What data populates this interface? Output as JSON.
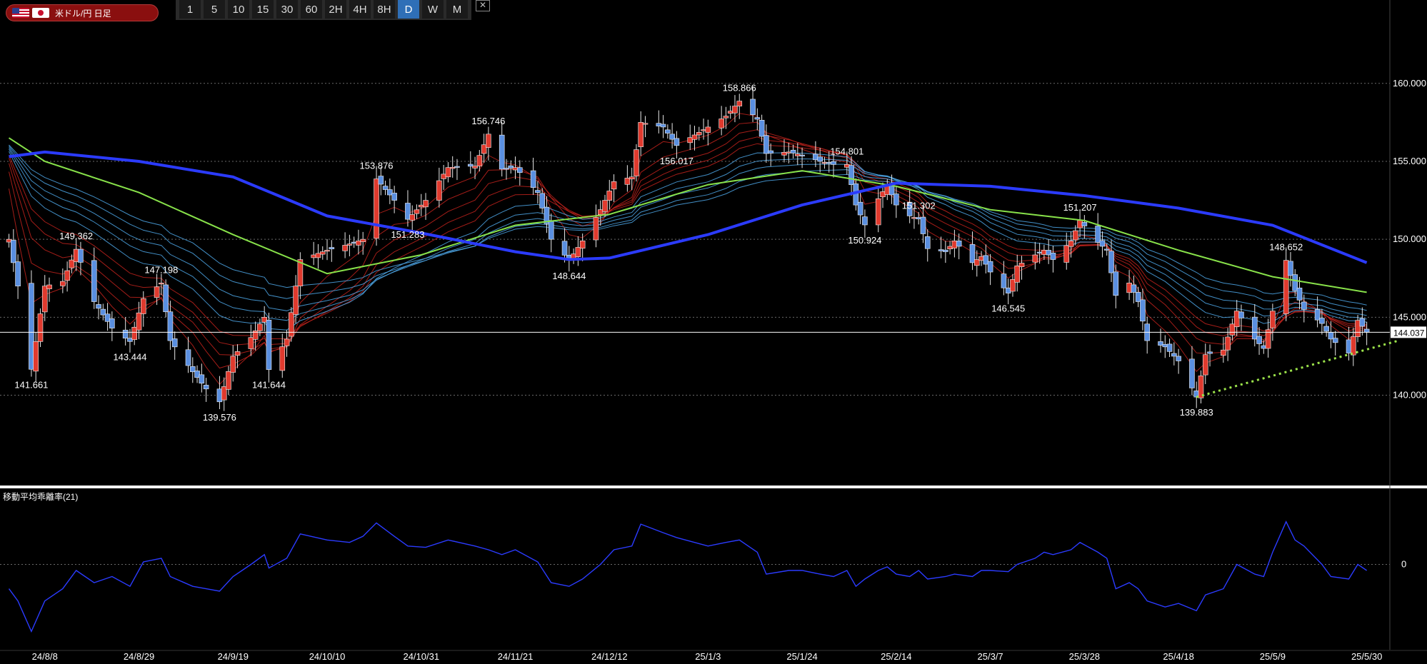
{
  "symbol": {
    "label": "米ドル/円 日足",
    "flags": [
      "us-flag-icon",
      "jp-flag-icon"
    ]
  },
  "timeframes": [
    "1",
    "5",
    "10",
    "15",
    "30",
    "60",
    "2H",
    "4H",
    "8H",
    "D",
    "W",
    "M"
  ],
  "active_timeframe": "D",
  "colors": {
    "background": "#000000",
    "bull": "#e03a2e",
    "bear": "#5a8fe0",
    "ma_long": "#2b3bff",
    "ma_mid": "#88e24a",
    "ribbon_red": "#c1221c",
    "ribbon_blue": "#4ea7e8",
    "deviation": "#2b3bff",
    "trendline": "#9be34a"
  },
  "chart_data": {
    "type": "candlestick",
    "price_axis": {
      "range": [
        134.3,
        162.6
      ],
      "ticks": [
        140.0,
        145.0,
        150.0,
        155.0,
        160.0
      ],
      "tick_labels": [
        "140.000",
        "145.000",
        "150.000",
        "155.000",
        "160.000"
      ]
    },
    "current_price": {
      "value": 144.037,
      "label": "144.037"
    },
    "x_axis_labels": [
      "24/8/8",
      "24/8/29",
      "24/9/19",
      "24/10/10",
      "24/10/31",
      "24/11/21",
      "24/12/12",
      "25/1/3",
      "25/1/24",
      "25/2/14",
      "25/3/7",
      "25/3/28",
      "25/4/18",
      "25/5/9",
      "25/5/30"
    ],
    "annotations": [
      {
        "label": "141.661",
        "value": 141.661,
        "date": "24/8/5",
        "pos": "below"
      },
      {
        "label": "149.362",
        "value": 149.362,
        "date": "24/8/15",
        "pos": "above"
      },
      {
        "label": "143.444",
        "value": 143.444,
        "date": "24/8/27",
        "pos": "below"
      },
      {
        "label": "147.198",
        "value": 147.198,
        "date": "24/9/3",
        "pos": "above"
      },
      {
        "label": "139.576",
        "value": 139.576,
        "date": "24/9/16",
        "pos": "below"
      },
      {
        "label": "141.644",
        "value": 141.644,
        "date": "24/9/27",
        "pos": "below"
      },
      {
        "label": "153.876",
        "value": 153.876,
        "date": "24/10/21",
        "pos": "above"
      },
      {
        "label": "151.283",
        "value": 151.283,
        "date": "24/10/28",
        "pos": "below"
      },
      {
        "label": "156.746",
        "value": 156.746,
        "date": "24/11/15",
        "pos": "above"
      },
      {
        "label": "148.644",
        "value": 148.644,
        "date": "24/12/3",
        "pos": "below"
      },
      {
        "label": "156.017",
        "value": 156.017,
        "date": "24/12/27",
        "pos": "below"
      },
      {
        "label": "158.866",
        "value": 158.866,
        "date": "25/1/10",
        "pos": "above"
      },
      {
        "label": "154.801",
        "value": 154.801,
        "date": "25/2/3",
        "pos": "above"
      },
      {
        "label": "150.924",
        "value": 150.924,
        "date": "25/2/7",
        "pos": "below"
      },
      {
        "label": "151.302",
        "value": 151.302,
        "date": "25/2/19",
        "pos": "above"
      },
      {
        "label": "146.545",
        "value": 146.545,
        "date": "25/3/11",
        "pos": "below"
      },
      {
        "label": "151.207",
        "value": 151.207,
        "date": "25/3/27",
        "pos": "above"
      },
      {
        "label": "139.883",
        "value": 139.883,
        "date": "25/4/22",
        "pos": "below"
      },
      {
        "label": "148.652",
        "value": 148.652,
        "date": "25/5/12",
        "pos": "above"
      }
    ],
    "price_path": [
      [
        "24/7/31",
        150.0
      ],
      [
        "24/8/2",
        147.0
      ],
      [
        "24/8/5",
        141.661
      ],
      [
        "24/8/8",
        147.0
      ],
      [
        "24/8/12",
        147.3
      ],
      [
        "24/8/15",
        149.362
      ],
      [
        "24/8/19",
        146.0
      ],
      [
        "24/8/23",
        144.3
      ],
      [
        "24/8/27",
        143.444
      ],
      [
        "24/8/30",
        146.2
      ],
      [
        "24/9/3",
        147.198
      ],
      [
        "24/9/5",
        143.5
      ],
      [
        "24/9/10",
        141.5
      ],
      [
        "24/9/13",
        140.4
      ],
      [
        "24/9/16",
        139.576
      ],
      [
        "24/9/19",
        142.5
      ],
      [
        "24/9/23",
        143.7
      ],
      [
        "24/9/26",
        145.0
      ],
      [
        "24/9/27",
        141.644
      ],
      [
        "24/10/1",
        143.6
      ],
      [
        "24/10/4",
        148.7
      ],
      [
        "24/10/10",
        149.3
      ],
      [
        "24/10/15",
        149.7
      ],
      [
        "24/10/18",
        150.0
      ],
      [
        "24/10/21",
        153.876
      ],
      [
        "24/10/25",
        152.5
      ],
      [
        "24/10/28",
        151.283
      ],
      [
        "24/11/1",
        152.5
      ],
      [
        "24/11/6",
        154.6
      ],
      [
        "24/11/12",
        154.7
      ],
      [
        "24/11/15",
        156.746
      ],
      [
        "24/11/18",
        154.5
      ],
      [
        "24/11/21",
        154.6
      ],
      [
        "24/11/26",
        153.0
      ],
      [
        "24/11/29",
        150.0
      ],
      [
        "24/12/3",
        148.644
      ],
      [
        "24/12/6",
        149.9
      ],
      [
        "24/12/10",
        151.9
      ],
      [
        "24/12/13",
        153.7
      ],
      [
        "24/12/17",
        154.0
      ],
      [
        "24/12/19",
        157.5
      ],
      [
        "24/12/24",
        157.2
      ],
      [
        "24/12/27",
        156.017
      ],
      [
        "25/1/3",
        157.2
      ],
      [
        "25/1/7",
        157.9
      ],
      [
        "25/1/10",
        158.866
      ],
      [
        "25/1/14",
        157.7
      ],
      [
        "25/1/16",
        155.5
      ],
      [
        "25/1/21",
        155.6
      ],
      [
        "25/1/24",
        155.4
      ],
      [
        "25/1/28",
        155.0
      ],
      [
        "25/1/31",
        154.8
      ],
      [
        "25/2/3",
        154.801
      ],
      [
        "25/2/5",
        152.2
      ],
      [
        "25/2/7",
        150.924
      ],
      [
        "25/2/10",
        152.6
      ],
      [
        "25/2/12",
        153.5
      ],
      [
        "25/2/14",
        152.2
      ],
      [
        "25/2/17",
        151.5
      ],
      [
        "25/2/19",
        151.302
      ],
      [
        "25/2/21",
        149.4
      ],
      [
        "25/2/25",
        149.2
      ],
      [
        "25/2/27",
        149.9
      ],
      [
        "25/3/3",
        148.5
      ],
      [
        "25/3/5",
        148.9
      ],
      [
        "25/3/7",
        147.9
      ],
      [
        "25/3/11",
        146.545
      ],
      [
        "25/3/13",
        148.3
      ],
      [
        "25/3/17",
        149.0
      ],
      [
        "25/3/19",
        149.3
      ],
      [
        "25/3/21",
        148.7
      ],
      [
        "25/3/25",
        149.9
      ],
      [
        "25/3/27",
        151.207
      ],
      [
        "25/3/31",
        149.8
      ],
      [
        "25/4/2",
        149.3
      ],
      [
        "25/4/4",
        146.4
      ],
      [
        "25/4/7",
        147.2
      ],
      [
        "25/4/9",
        146.0
      ],
      [
        "25/4/11",
        143.5
      ],
      [
        "25/4/15",
        143.1
      ],
      [
        "25/4/18",
        142.2
      ],
      [
        "25/4/22",
        139.883
      ],
      [
        "25/4/24",
        142.6
      ],
      [
        "25/4/28",
        142.9
      ],
      [
        "25/5/1",
        145.4
      ],
      [
        "25/5/5",
        143.6
      ],
      [
        "25/5/7",
        143.0
      ],
      [
        "25/5/9",
        145.4
      ],
      [
        "25/5/12",
        148.652
      ],
      [
        "25/5/14",
        146.7
      ],
      [
        "25/5/16",
        145.5
      ],
      [
        "25/5/20",
        144.6
      ],
      [
        "25/5/22",
        143.6
      ],
      [
        "25/5/26",
        142.7
      ],
      [
        "25/5/28",
        144.8
      ],
      [
        "25/5/30",
        144.037
      ]
    ],
    "ma_long": [
      [
        "24/7/31",
        155.3
      ],
      [
        "24/8/8",
        155.6
      ],
      [
        "24/8/29",
        155.0
      ],
      [
        "24/9/19",
        154.0
      ],
      [
        "24/10/10",
        151.5
      ],
      [
        "24/10/31",
        150.4
      ],
      [
        "24/11/21",
        149.2
      ],
      [
        "24/12/3",
        148.7
      ],
      [
        "24/12/12",
        148.8
      ],
      [
        "25/1/3",
        150.3
      ],
      [
        "25/1/24",
        152.2
      ],
      [
        "25/2/14",
        153.6
      ],
      [
        "25/3/7",
        153.4
      ],
      [
        "25/3/28",
        152.8
      ],
      [
        "25/4/18",
        152.0
      ],
      [
        "25/5/9",
        150.9
      ],
      [
        "25/5/30",
        148.5
      ]
    ],
    "ma_mid": [
      [
        "24/7/31",
        156.5
      ],
      [
        "24/8/8",
        155.0
      ],
      [
        "24/8/29",
        153.0
      ],
      [
        "24/9/19",
        150.3
      ],
      [
        "24/10/10",
        147.8
      ],
      [
        "24/10/31",
        149.0
      ],
      [
        "24/11/21",
        150.9
      ],
      [
        "24/12/12",
        151.6
      ],
      [
        "25/1/3",
        153.5
      ],
      [
        "25/1/24",
        154.4
      ],
      [
        "25/2/14",
        153.4
      ],
      [
        "25/3/7",
        151.9
      ],
      [
        "25/3/28",
        151.2
      ],
      [
        "25/4/18",
        149.3
      ],
      [
        "25/5/9",
        147.6
      ],
      [
        "25/5/30",
        146.6
      ]
    ],
    "trendline": {
      "from": {
        "date": "25/4/22",
        "value": 139.883
      },
      "to": {
        "date": "25/6/12",
        "value": 143.5
      }
    },
    "indicator": {
      "title": "移動平均乖離率(21)",
      "zero_label": "0",
      "range": [
        -7,
        6
      ],
      "values": [
        [
          "24/7/31",
          -2.0
        ],
        [
          "24/8/2",
          -3.0
        ],
        [
          "24/8/5",
          -5.5
        ],
        [
          "24/8/8",
          -3.0
        ],
        [
          "24/8/12",
          -2.0
        ],
        [
          "24/8/15",
          -0.5
        ],
        [
          "24/8/19",
          -1.5
        ],
        [
          "24/8/23",
          -1.0
        ],
        [
          "24/8/27",
          -1.8
        ],
        [
          "24/8/30",
          0.2
        ],
        [
          "24/9/3",
          0.5
        ],
        [
          "24/9/5",
          -1.0
        ],
        [
          "24/9/10",
          -1.8
        ],
        [
          "24/9/13",
          -2.0
        ],
        [
          "24/9/16",
          -2.2
        ],
        [
          "24/9/19",
          -1.0
        ],
        [
          "24/9/23",
          0.0
        ],
        [
          "24/9/26",
          0.8
        ],
        [
          "24/9/27",
          -0.3
        ],
        [
          "24/10/1",
          0.5
        ],
        [
          "24/10/4",
          2.5
        ],
        [
          "24/10/10",
          2.0
        ],
        [
          "24/10/15",
          1.8
        ],
        [
          "24/10/18",
          2.3
        ],
        [
          "24/10/21",
          3.4
        ],
        [
          "24/10/25",
          2.3
        ],
        [
          "24/10/28",
          1.5
        ],
        [
          "24/11/1",
          1.4
        ],
        [
          "24/11/6",
          2.0
        ],
        [
          "24/11/12",
          1.5
        ],
        [
          "24/11/15",
          1.2
        ],
        [
          "24/11/18",
          0.8
        ],
        [
          "24/11/21",
          1.2
        ],
        [
          "24/11/26",
          0.2
        ],
        [
          "24/11/29",
          -1.5
        ],
        [
          "24/12/3",
          -1.8
        ],
        [
          "24/12/6",
          -1.2
        ],
        [
          "24/12/10",
          0.0
        ],
        [
          "24/12/13",
          1.2
        ],
        [
          "24/12/17",
          1.5
        ],
        [
          "24/12/19",
          3.3
        ],
        [
          "24/12/24",
          2.6
        ],
        [
          "24/12/27",
          2.2
        ],
        [
          "25/1/3",
          1.5
        ],
        [
          "25/1/7",
          1.8
        ],
        [
          "25/1/10",
          2.0
        ],
        [
          "25/1/14",
          1.0
        ],
        [
          "25/1/16",
          -0.8
        ],
        [
          "25/1/21",
          -0.5
        ],
        [
          "25/1/24",
          -0.5
        ],
        [
          "25/1/28",
          -0.8
        ],
        [
          "25/1/31",
          -1.0
        ],
        [
          "25/2/3",
          -0.5
        ],
        [
          "25/2/5",
          -1.8
        ],
        [
          "25/2/7",
          -1.2
        ],
        [
          "25/2/10",
          -0.5
        ],
        [
          "25/2/12",
          -0.2
        ],
        [
          "25/2/14",
          -0.8
        ],
        [
          "25/2/17",
          -1.0
        ],
        [
          "25/2/19",
          -0.5
        ],
        [
          "25/2/21",
          -1.2
        ],
        [
          "25/2/25",
          -1.0
        ],
        [
          "25/2/27",
          -0.8
        ],
        [
          "25/3/3",
          -1.0
        ],
        [
          "25/3/5",
          -0.5
        ],
        [
          "25/3/7",
          -0.5
        ],
        [
          "25/3/11",
          -0.6
        ],
        [
          "25/3/13",
          0.0
        ],
        [
          "25/3/17",
          0.5
        ],
        [
          "25/3/19",
          1.0
        ],
        [
          "25/3/21",
          0.8
        ],
        [
          "25/3/25",
          1.2
        ],
        [
          "25/3/27",
          1.8
        ],
        [
          "25/3/31",
          1.0
        ],
        [
          "25/4/2",
          0.5
        ],
        [
          "25/4/4",
          -2.0
        ],
        [
          "25/4/7",
          -1.5
        ],
        [
          "25/4/9",
          -2.0
        ],
        [
          "25/4/11",
          -3.0
        ],
        [
          "25/4/15",
          -3.5
        ],
        [
          "25/4/18",
          -3.2
        ],
        [
          "25/4/22",
          -3.8
        ],
        [
          "25/4/24",
          -2.5
        ],
        [
          "25/4/28",
          -2.0
        ],
        [
          "25/5/1",
          0.0
        ],
        [
          "25/5/5",
          -0.8
        ],
        [
          "25/5/7",
          -1.0
        ],
        [
          "25/5/9",
          1.0
        ],
        [
          "25/5/12",
          3.5
        ],
        [
          "25/5/14",
          2.0
        ],
        [
          "25/5/16",
          1.5
        ],
        [
          "25/5/20",
          0.0
        ],
        [
          "25/5/22",
          -1.0
        ],
        [
          "25/5/26",
          -1.2
        ],
        [
          "25/5/28",
          0.0
        ],
        [
          "25/5/30",
          -0.5
        ]
      ]
    }
  }
}
